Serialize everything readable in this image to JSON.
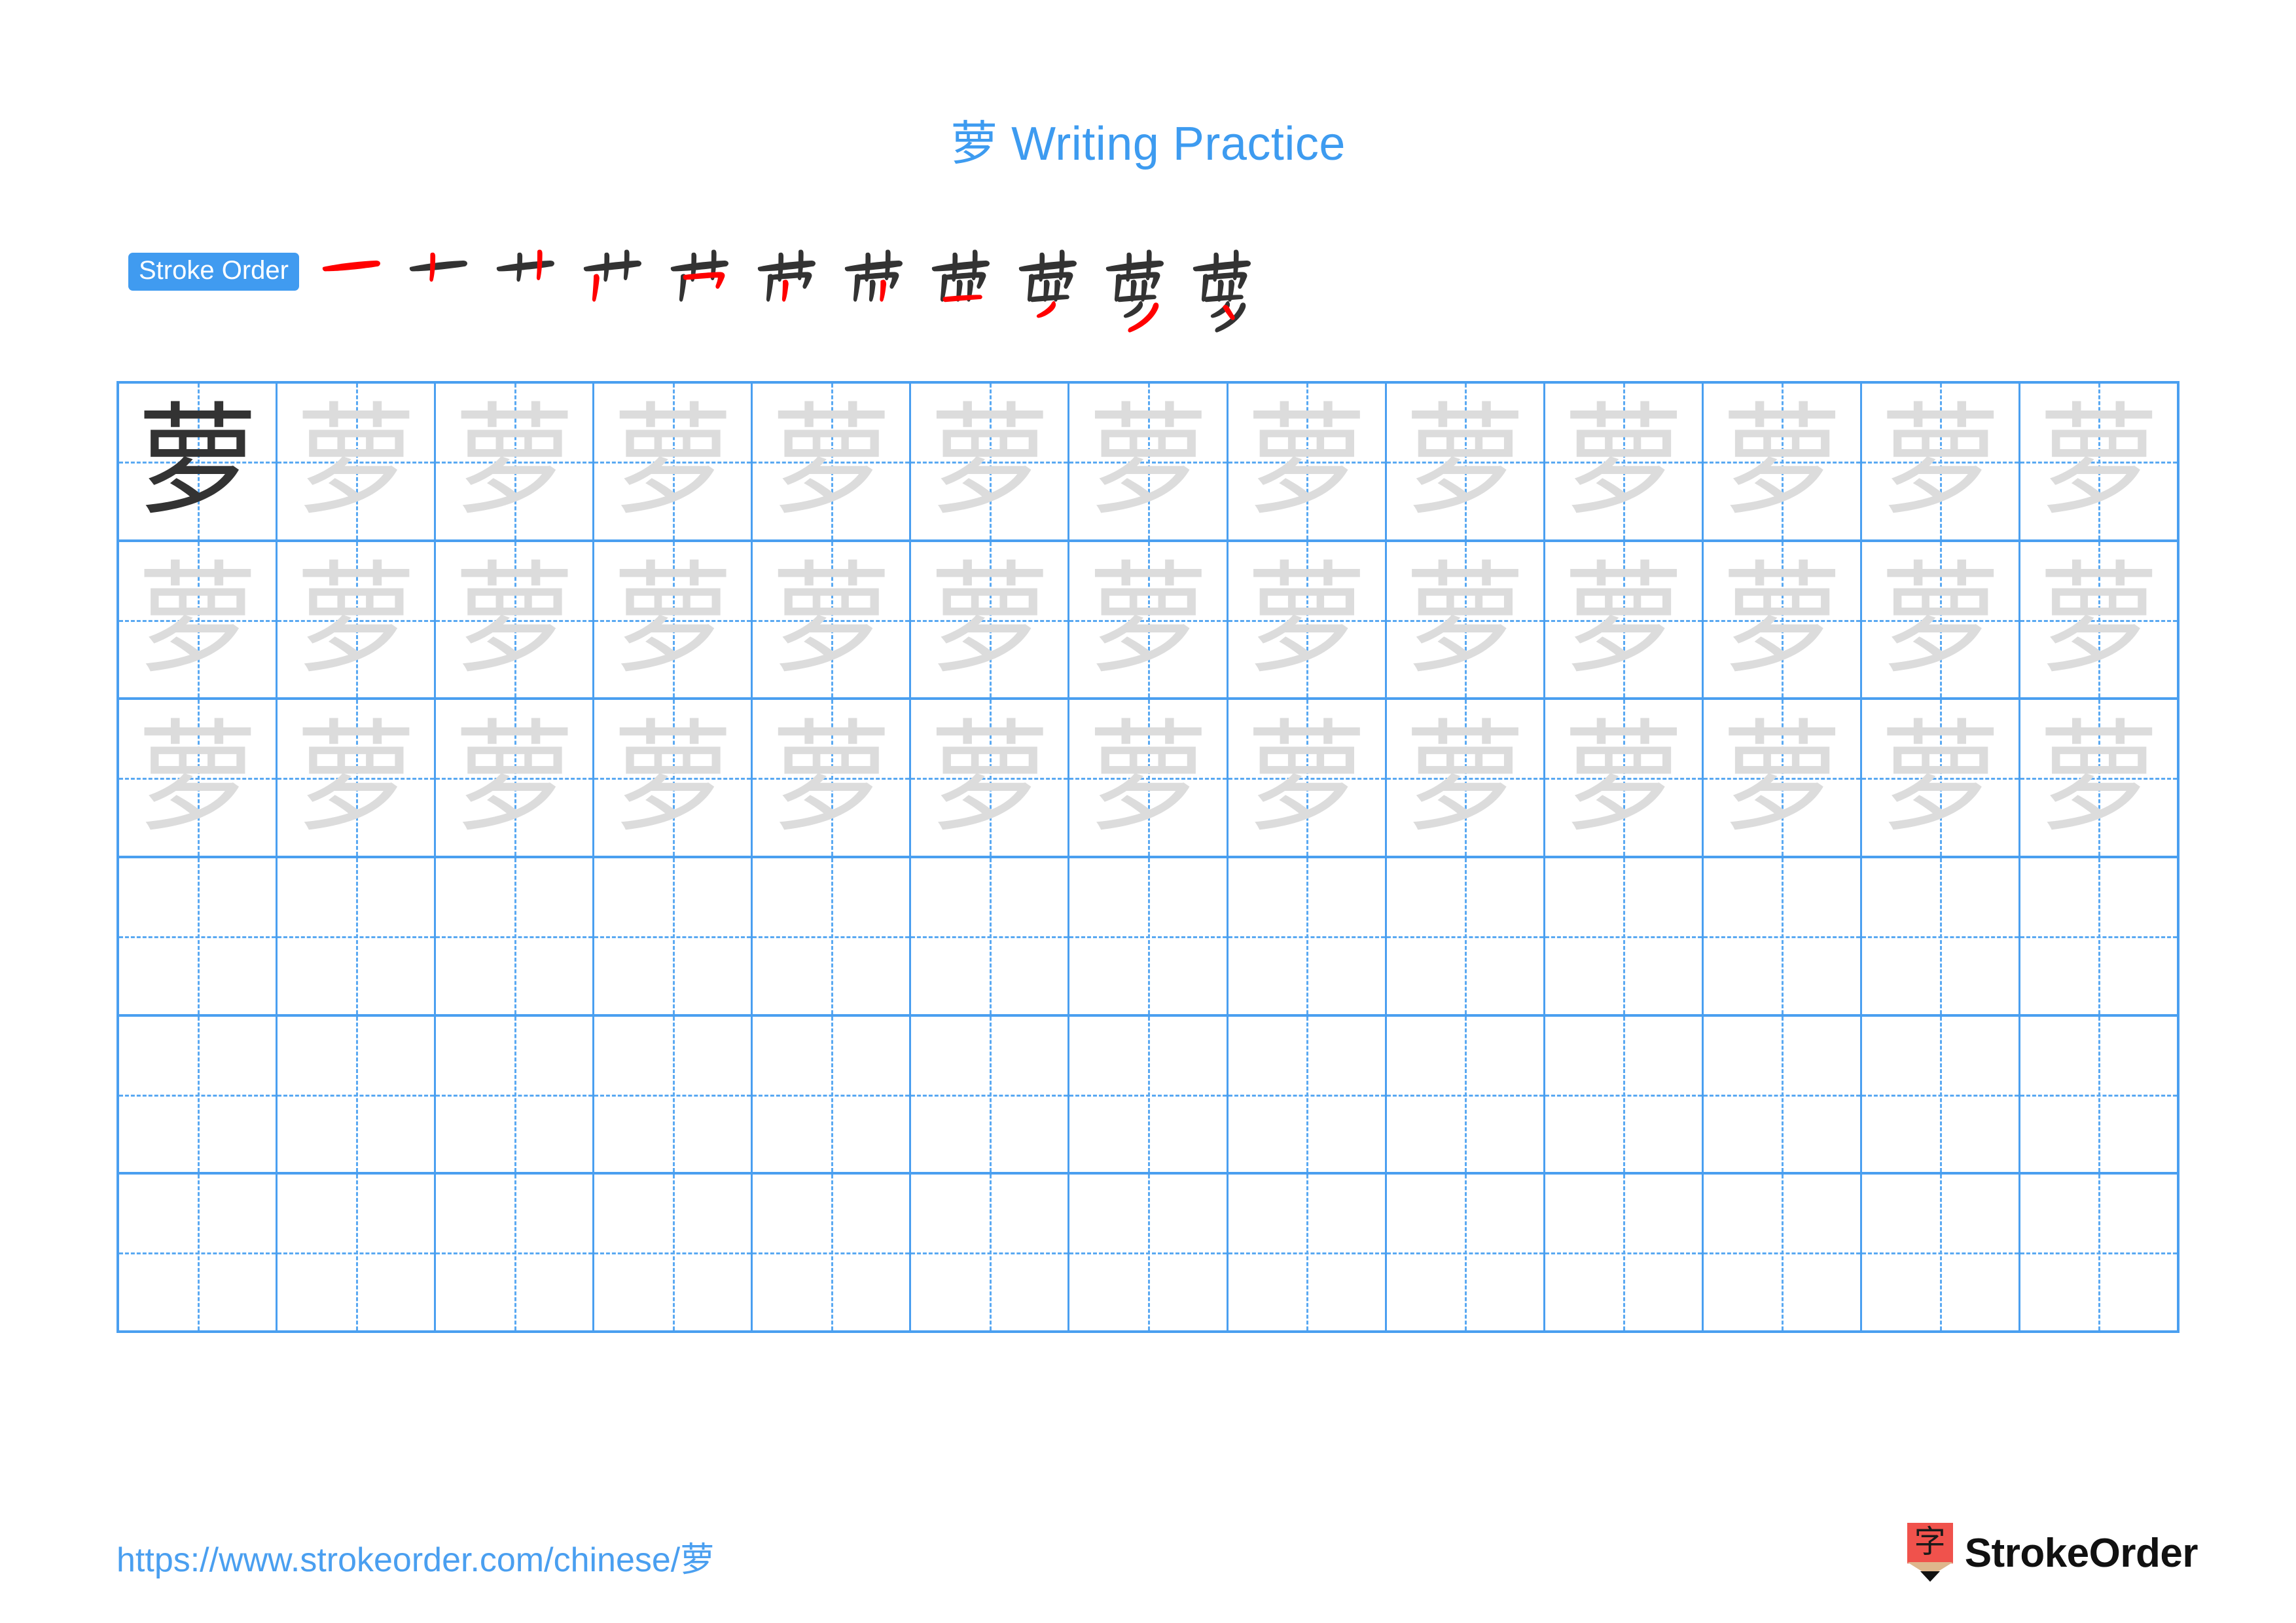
{
  "header": {
    "character": "萝",
    "title_suffix": " Writing Practice",
    "title_full": "萝 Writing Practice",
    "title_color": "#3d9bf0"
  },
  "stroke_order": {
    "badge_label": "Stroke Order",
    "badge_bg": "#409bf0",
    "badge_text_color": "#ffffff",
    "stroke_count": 11,
    "current_stroke_color": "#ff0000",
    "completed_stroke_color": "#333333",
    "steps": [
      {
        "index": 1,
        "partial": "一"
      },
      {
        "index": 2,
        "partial": "十"
      },
      {
        "index": 3,
        "partial": "艹"
      },
      {
        "index": 4,
        "partial": "艹"
      },
      {
        "index": 5,
        "partial": "艹"
      },
      {
        "index": 6,
        "partial": "芇"
      },
      {
        "index": 7,
        "partial": "茁"
      },
      {
        "index": 8,
        "partial": "苗"
      },
      {
        "index": 9,
        "partial": "苗"
      },
      {
        "index": 10,
        "partial": "萝"
      },
      {
        "index": 11,
        "partial": "萝"
      }
    ]
  },
  "practice_grid": {
    "columns": 13,
    "rows": 6,
    "grid_line_color": "#4a9ff0",
    "guide_line_color": "#5aa9f2",
    "solid_glyph_color": "#333333",
    "trace_glyph_color": "#dcdcdc",
    "cells": [
      [
        "solid",
        "trace",
        "trace",
        "trace",
        "trace",
        "trace",
        "trace",
        "trace",
        "trace",
        "trace",
        "trace",
        "trace",
        "trace"
      ],
      [
        "trace",
        "trace",
        "trace",
        "trace",
        "trace",
        "trace",
        "trace",
        "trace",
        "trace",
        "trace",
        "trace",
        "trace",
        "trace"
      ],
      [
        "trace",
        "trace",
        "trace",
        "trace",
        "trace",
        "trace",
        "trace",
        "trace",
        "trace",
        "trace",
        "trace",
        "trace",
        "trace"
      ],
      [
        "blank",
        "blank",
        "blank",
        "blank",
        "blank",
        "blank",
        "blank",
        "blank",
        "blank",
        "blank",
        "blank",
        "blank",
        "blank"
      ],
      [
        "blank",
        "blank",
        "blank",
        "blank",
        "blank",
        "blank",
        "blank",
        "blank",
        "blank",
        "blank",
        "blank",
        "blank",
        "blank"
      ],
      [
        "blank",
        "blank",
        "blank",
        "blank",
        "blank",
        "blank",
        "blank",
        "blank",
        "blank",
        "blank",
        "blank",
        "blank",
        "blank"
      ]
    ]
  },
  "footer": {
    "url_prefix": "https://www.strokeorder.com/chinese/",
    "url_char": "萝",
    "url_full": "https://www.strokeorder.com/chinese/萝",
    "url_color": "#4a9ff0",
    "brand_name": "StrokeOrder",
    "logo_char": "字",
    "logo_body_color": "#f0524c",
    "logo_wood_color": "#deb68c",
    "logo_tip_color": "#111111"
  }
}
